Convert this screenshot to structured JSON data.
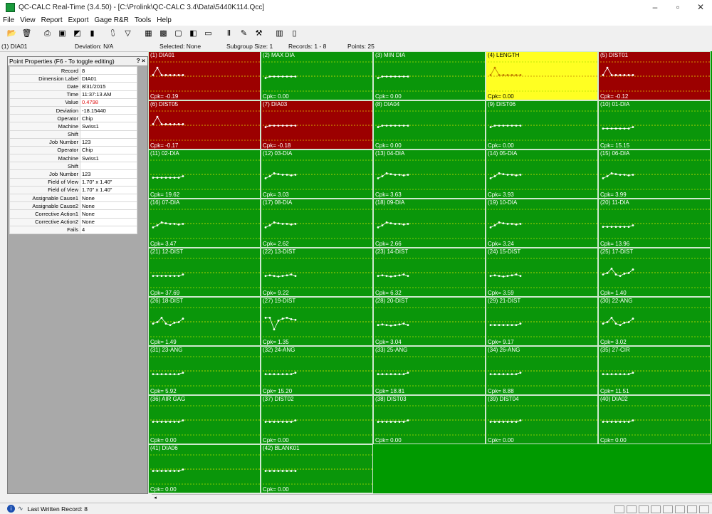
{
  "window": {
    "title": "QC-CALC Real-Time (3.4.50) - [C:\\Prolink\\QC-CALC 3.4\\Data\\5440K114.Qcc]",
    "controls": {
      "minimize": "–",
      "maximize": "▫",
      "close": "✕"
    }
  },
  "menu": [
    "File",
    "View",
    "Report",
    "Export",
    "Gage R&R",
    "Tools",
    "Help"
  ],
  "toolbar": {
    "icons": [
      "folder-open-icon",
      "trash-icon",
      "sep",
      "print-icon",
      "preview-icon",
      "chart-icon",
      "bucket-icon",
      "sep",
      "control-chart-icon",
      "filter-icon",
      "sep",
      "green-grid-icon",
      "green-grid2-icon",
      "box-icon",
      "doc-icon",
      "window-icon",
      "sep",
      "pause-icon",
      "tag-icon",
      "tools-icon",
      "sep",
      "bar-chart-icon",
      "clipboard-icon"
    ]
  },
  "status_strip": {
    "selected_feature": "(1) DIA01",
    "deviation": "Deviation: N/A",
    "selected": "Selected: None",
    "subgroup": "Subgroup Size: 1",
    "records": "Records: 1 - 8",
    "points": "Points: 25"
  },
  "point_properties": {
    "header": "Point Properties (F6 - To toggle editing)",
    "controls": "? ×",
    "rows": [
      {
        "k": "Record",
        "v": "8"
      },
      {
        "k": "Dimension Label",
        "v": "DIA01"
      },
      {
        "k": "Date",
        "v": "8/31/2015"
      },
      {
        "k": "Time",
        "v": "11:37:13 AM"
      },
      {
        "k": "Value",
        "v": "0.4798",
        "red": true
      },
      {
        "k": "Deviation",
        "v": "-18.15440"
      },
      {
        "k": "Operator",
        "v": "Chip"
      },
      {
        "k": "Machine",
        "v": "Swiss1"
      },
      {
        "k": "Shift",
        "v": ""
      },
      {
        "k": "Job Number",
        "v": "123"
      },
      {
        "k": "Operator",
        "v": "Chip"
      },
      {
        "k": "Machine",
        "v": "Swiss1"
      },
      {
        "k": "Shift",
        "v": ""
      },
      {
        "k": "Job Number",
        "v": "123"
      },
      {
        "k": "Field of View",
        "v": "1.70\" x 1.40\""
      },
      {
        "k": "Field of View",
        "v": "1.70\" x 1.40\""
      },
      {
        "k": "Assignable Cause1",
        "v": "None"
      },
      {
        "k": "Assignable Cause2",
        "v": "None"
      },
      {
        "k": "Corrective Action1",
        "v": "None"
      },
      {
        "k": "Corrective Action2",
        "v": "None"
      },
      {
        "k": "Fails",
        "v": "4"
      }
    ]
  },
  "features": [
    {
      "label": "(1) DIA01",
      "cpk": "Cpk= -0.19",
      "status": "red",
      "pattern": "a"
    },
    {
      "label": "(2) MAX DIA",
      "cpk": "Cpk= 0.00",
      "status": "green",
      "pattern": "b"
    },
    {
      "label": "(3) MIN DIA",
      "cpk": "Cpk= 0.00",
      "status": "green",
      "pattern": "b"
    },
    {
      "label": "(4) LENGTH",
      "cpk": "Cpk= 0.00",
      "status": "yellow",
      "pattern": "a"
    },
    {
      "label": "(5) DIST01",
      "cpk": "Cpk= -0.12",
      "status": "red",
      "pattern": "a"
    },
    {
      "label": "(6) DIST05",
      "cpk": "Cpk= -0.17",
      "status": "red",
      "pattern": "a"
    },
    {
      "label": "(7) DIA03",
      "cpk": "Cpk= -0.18",
      "status": "red",
      "pattern": "b"
    },
    {
      "label": "(8) DIA04",
      "cpk": "Cpk= 0.00",
      "status": "green",
      "pattern": "b"
    },
    {
      "label": "(9) DIST06",
      "cpk": "Cpk= 0.00",
      "status": "green",
      "pattern": "b"
    },
    {
      "label": "(10) 01-DIA",
      "cpk": "Cpk= 15.15",
      "status": "green",
      "pattern": "c"
    },
    {
      "label": "(11) 02-DIA",
      "cpk": "Cpk= 19.62",
      "status": "green",
      "pattern": "c"
    },
    {
      "label": "(12) 03-DIA",
      "cpk": "Cpk= 3.03",
      "status": "green",
      "pattern": "d"
    },
    {
      "label": "(13) 04-DIA",
      "cpk": "Cpk= 3.63",
      "status": "green",
      "pattern": "d"
    },
    {
      "label": "(14) 05-DIA",
      "cpk": "Cpk= 3.93",
      "status": "green",
      "pattern": "d"
    },
    {
      "label": "(15) 06-DIA",
      "cpk": "Cpk= 3.99",
      "status": "green",
      "pattern": "d"
    },
    {
      "label": "(16) 07-DIA",
      "cpk": "Cpk= 3.47",
      "status": "green",
      "pattern": "d"
    },
    {
      "label": "(17) 08-DIA",
      "cpk": "Cpk= 2.62",
      "status": "green",
      "pattern": "d"
    },
    {
      "label": "(18) 09-DIA",
      "cpk": "Cpk= 2.66",
      "status": "green",
      "pattern": "d"
    },
    {
      "label": "(19) 10-DIA",
      "cpk": "Cpk= 3.24",
      "status": "green",
      "pattern": "d"
    },
    {
      "label": "(20) 11-DIA",
      "cpk": "Cpk= 13.96",
      "status": "green",
      "pattern": "c"
    },
    {
      "label": "(21) 12-DIST",
      "cpk": "Cpk= 37.69",
      "status": "green",
      "pattern": "c"
    },
    {
      "label": "(22) 13-DIST",
      "cpk": "Cpk= 9.22",
      "status": "green",
      "pattern": "e"
    },
    {
      "label": "(23) 14-DIST",
      "cpk": "Cpk= 6.32",
      "status": "green",
      "pattern": "e"
    },
    {
      "label": "(24) 15-DIST",
      "cpk": "Cpk= 3.59",
      "status": "green",
      "pattern": "e"
    },
    {
      "label": "(25) 17-DIST",
      "cpk": "Cpk= 1.40",
      "status": "green",
      "pattern": "f"
    },
    {
      "label": "(26) 18-DIST",
      "cpk": "Cpk= 1.49",
      "status": "green",
      "pattern": "f"
    },
    {
      "label": "(27) 19-DIST",
      "cpk": "Cpk= 1.35",
      "status": "green",
      "pattern": "g"
    },
    {
      "label": "(28) 20-DIST",
      "cpk": "Cpk= 3.04",
      "status": "green",
      "pattern": "e"
    },
    {
      "label": "(29) 21-DIST",
      "cpk": "Cpk= 9.17",
      "status": "green",
      "pattern": "c"
    },
    {
      "label": "(30) 22-ANG",
      "cpk": "Cpk= 3.02",
      "status": "green",
      "pattern": "f"
    },
    {
      "label": "(31) 23-ANG",
      "cpk": "Cpk= 5.92",
      "status": "green",
      "pattern": "c"
    },
    {
      "label": "(32) 24-ANG",
      "cpk": "Cpk= 15.20",
      "status": "green",
      "pattern": "c"
    },
    {
      "label": "(33) 25-ANG",
      "cpk": "Cpk= 18.81",
      "status": "green",
      "pattern": "c"
    },
    {
      "label": "(34) 26-ANG",
      "cpk": "Cpk= 8.88",
      "status": "green",
      "pattern": "c"
    },
    {
      "label": "(35) 27-CIR",
      "cpk": "Cpk= 11.51",
      "status": "green",
      "pattern": "c"
    },
    {
      "label": "(36) AIR GAG",
      "cpk": "Cpk= 0.00",
      "status": "green",
      "pattern": "h"
    },
    {
      "label": "(37) DIST02",
      "cpk": "Cpk= 0.00",
      "status": "green",
      "pattern": "h"
    },
    {
      "label": "(38) DIST03",
      "cpk": "Cpk= 0.00",
      "status": "green",
      "pattern": "h"
    },
    {
      "label": "(39) DIST04",
      "cpk": "Cpk= 0.00",
      "status": "green",
      "pattern": "h"
    },
    {
      "label": "(40) DIA02",
      "cpk": "Cpk= 0.00",
      "status": "green",
      "pattern": "h"
    },
    {
      "label": "(41) DIA06",
      "cpk": "Cpk= 0.00",
      "status": "green",
      "pattern": "h"
    },
    {
      "label": "(42) BLANK01",
      "cpk": "Cpk= 0.00",
      "status": "green",
      "pattern": "i"
    }
  ],
  "statusbar": {
    "text": "Last Written Record: 8"
  },
  "colors": {
    "ok": "#0a960a",
    "fail": "#9c0000",
    "warn": "#ffff22",
    "grid_bg": "#009a00"
  }
}
